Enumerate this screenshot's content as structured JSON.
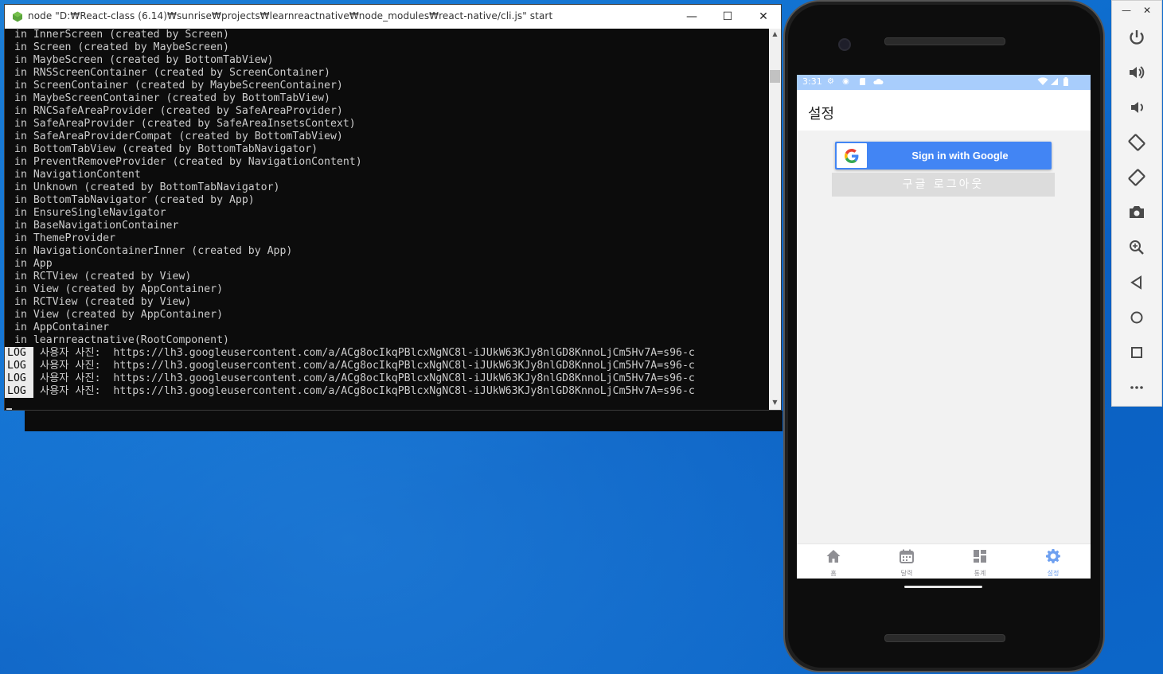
{
  "console": {
    "title": "node  \"D:₩React-class (6.14)₩sunrise₩projects₩learnreactnative₩node_modules₩react-native/cli.js\" start",
    "lines": [
      "in InnerScreen (created by Screen)",
      "in Screen (created by MaybeScreen)",
      "in MaybeScreen (created by BottomTabView)",
      "in RNSScreenContainer (created by ScreenContainer)",
      "in ScreenContainer (created by MaybeScreenContainer)",
      "in MaybeScreenContainer (created by BottomTabView)",
      "in RNCSafeAreaProvider (created by SafeAreaProvider)",
      "in SafeAreaProvider (created by SafeAreaInsetsContext)",
      "in SafeAreaProviderCompat (created by BottomTabView)",
      "in BottomTabView (created by BottomTabNavigator)",
      "in PreventRemoveProvider (created by NavigationContent)",
      "in NavigationContent",
      "in Unknown (created by BottomTabNavigator)",
      "in BottomTabNavigator (created by App)",
      "in EnsureSingleNavigator",
      "in BaseNavigationContainer",
      "in ThemeProvider",
      "in NavigationContainerInner (created by App)",
      "in App",
      "in RCTView (created by View)",
      "in View (created by AppContainer)",
      "in RCTView (created by View)",
      "in View (created by AppContainer)",
      "in AppContainer",
      "in learnreactnative(RootComponent)"
    ],
    "log_tag": "LOG",
    "log_lines": [
      "사용자 사진:  https://lh3.googleusercontent.com/a/ACg8ocIkqPBlcxNgNC8l-iJUkW63KJy8nlGD8KnnoLjCm5Hv7A=s96-c",
      "사용자 사진:  https://lh3.googleusercontent.com/a/ACg8ocIkqPBlcxNgNC8l-iJUkW63KJy8nlGD8KnnoLjCm5Hv7A=s96-c",
      "사용자 사진:  https://lh3.googleusercontent.com/a/ACg8ocIkqPBlcxNgNC8l-iJUkW63KJy8nlGD8KnnoLjCm5Hv7A=s96-c",
      "사용자 사진:  https://lh3.googleusercontent.com/a/ACg8ocIkqPBlcxNgNC8l-iJUkW63KJy8nlGD8KnnoLjCm5Hv7A=s96-c"
    ]
  },
  "phone": {
    "status_time": "3:31",
    "header_title": "설정",
    "google_button": "Sign in with Google",
    "logout_button": "구글 로그아웃",
    "tabs": [
      {
        "label": "홈",
        "icon": "home-icon",
        "active": false
      },
      {
        "label": "달력",
        "icon": "calendar-icon",
        "active": false
      },
      {
        "label": "통계",
        "icon": "dashboard-icon",
        "active": false
      },
      {
        "label": "설정",
        "icon": "settings-icon",
        "active": true
      }
    ],
    "colors": {
      "status_bar": "#a8cdfc",
      "google_blue": "#4285f4",
      "active_tab": "#6ea0f0"
    }
  },
  "emulator_toolbar": {
    "buttons": [
      "power-icon",
      "volume-up-icon",
      "volume-down-icon",
      "rotate-left-icon",
      "rotate-right-icon",
      "camera-icon",
      "zoom-icon",
      "back-icon",
      "home-icon",
      "overview-icon",
      "more-icon"
    ]
  }
}
